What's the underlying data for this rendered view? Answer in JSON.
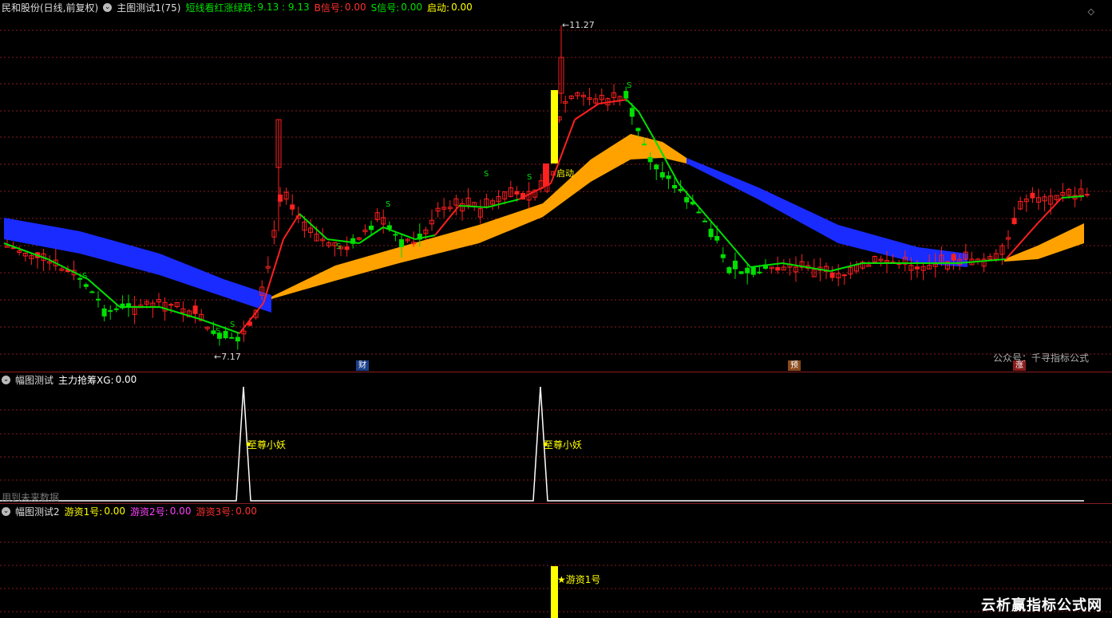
{
  "main": {
    "stock_name": "民和股份(日线,前复权)",
    "indicator": "主图测试1(75)",
    "legend_label": "短线看红涨绿跌:",
    "legend_value": "9.13 : 9.13",
    "b_signal_label": "B信号:",
    "b_signal_value": "0.00",
    "s_signal_label": "S信号:",
    "s_signal_value": "0.00",
    "start_label": "启动:",
    "start_value": "0.00",
    "high_label": "11.27",
    "low_label": "7.17",
    "start_annotation": "启动",
    "s_letter": "S",
    "badge_cai": "财",
    "badge_yu": "预",
    "badge_zhang": "涨",
    "watermark": "公众号：千寻指标公式",
    "diamond": "◇"
  },
  "sub1": {
    "title": "幅图测试",
    "series_label": "主力抢筹XG:",
    "series_value": "0.00",
    "annotation": "至尊小妖",
    "future_note": "用到未来数据"
  },
  "sub2": {
    "title": "幅图测试2",
    "s1_label": "游资1号:",
    "s1_value": "0.00",
    "s2_label": "游资2号:",
    "s2_value": "0.00",
    "s3_label": "游资3号:",
    "s3_value": "0.00",
    "annotation": "游资1号"
  },
  "footer_watermark": "云析赢指标公式网",
  "colors": {
    "up": "#ff2020",
    "down": "#00e000",
    "blue_band": "#1a2bff",
    "orange_band": "#ffa200",
    "yellow": "#ffff00",
    "grid": "#8a1c1c"
  },
  "chart_data": {
    "type": "candlestick",
    "high": 11.27,
    "low": 7.17,
    "peak_days": [
      0,
      0
    ]
  }
}
